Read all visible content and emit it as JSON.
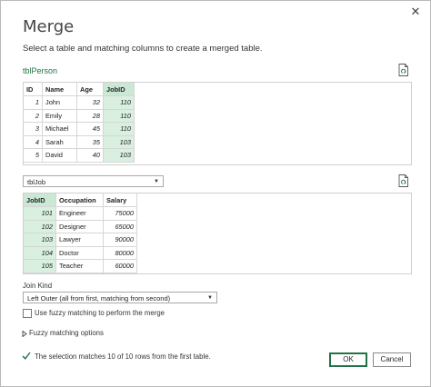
{
  "dialog": {
    "title": "Merge",
    "close_glyph": "✕",
    "subtitle": "Select a table and matching columns to create a merged table."
  },
  "first_table": {
    "name": "tblPerson",
    "columns": [
      "ID",
      "Name",
      "Age",
      "JobID"
    ],
    "rows": [
      [
        "1",
        "John",
        "32",
        "110"
      ],
      [
        "2",
        "Emily",
        "28",
        "110"
      ],
      [
        "3",
        "Michael",
        "45",
        "110"
      ],
      [
        "4",
        "Sarah",
        "35",
        "103"
      ],
      [
        "5",
        "David",
        "40",
        "103"
      ]
    ],
    "selected_column": "JobID"
  },
  "second_table": {
    "dropdown_value": "tblJob",
    "columns": [
      "JobID",
      "Occupation",
      "Salary"
    ],
    "rows": [
      [
        "101",
        "Engineer",
        "75000"
      ],
      [
        "102",
        "Designer",
        "65000"
      ],
      [
        "103",
        "Lawyer",
        "90000"
      ],
      [
        "104",
        "Doctor",
        "80000"
      ],
      [
        "105",
        "Teacher",
        "60000"
      ]
    ],
    "selected_column": "JobID"
  },
  "join": {
    "label": "Join Kind",
    "value": "Left Outer (all from first, matching from second)",
    "fuzzy_checkbox_label": "Use fuzzy matching to perform the merge",
    "fuzzy_checked": false,
    "fuzzy_options_label": "Fuzzy matching options"
  },
  "status": {
    "message": "The selection matches 10 of 10 rows from the first table."
  },
  "buttons": {
    "ok": "OK",
    "cancel": "Cancel"
  },
  "colors": {
    "accent": "#217346",
    "selected_column_fill": "#d9efdf"
  },
  "icons": {
    "refresh_first": "document-refresh-icon",
    "refresh_second": "document-refresh-icon",
    "status": "checkmark-icon",
    "expand": "triangle-right-icon",
    "dropdown": "chevron-down-icon"
  }
}
